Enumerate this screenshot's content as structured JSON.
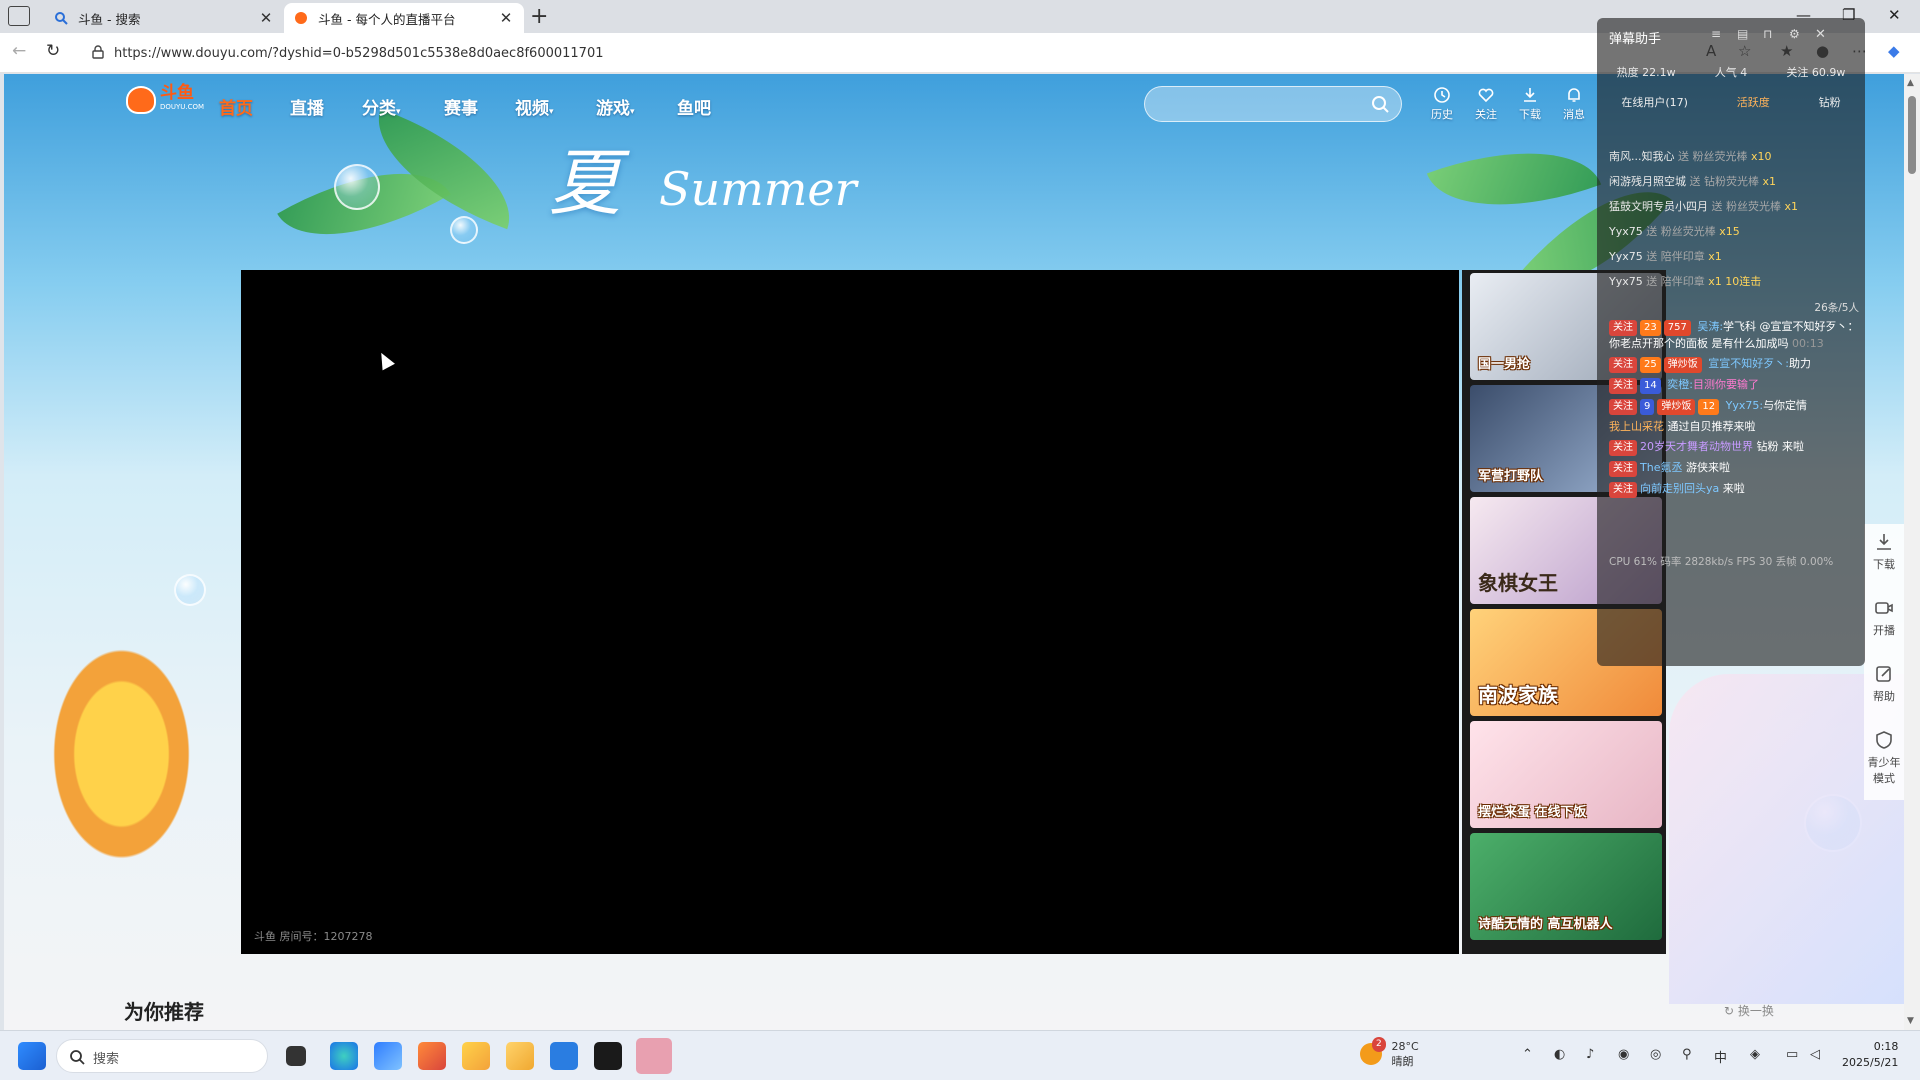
{
  "browser": {
    "tabs": [
      {
        "title": "斗鱼 - 搜索",
        "active": false
      },
      {
        "title": "斗鱼 - 每个人的直播平台",
        "active": true
      }
    ],
    "url": "https://www.douyu.com/?dyshid=0-b5298d501c5538e8d0aec8f600011701"
  },
  "site": {
    "logo_text": "斗鱼",
    "logo_sub": "DOUYU.COM",
    "nav": [
      "首页",
      "直播",
      "分类",
      "赛事",
      "视频",
      "游戏",
      "鱼吧"
    ],
    "tools": [
      "历史",
      "关注",
      "下载",
      "消息"
    ],
    "room_label": "斗鱼 房间号：1207278",
    "recommend_title": "为你推荐",
    "refresh_label": "换一换",
    "thumbs": [
      {
        "caption": "国一男抢"
      },
      {
        "caption": "军营打野队"
      },
      {
        "caption": "象棋女王"
      },
      {
        "caption": "南波家族"
      },
      {
        "caption": "摆烂来蛋 在线下饭"
      },
      {
        "caption": "诗酷无情的 高互机器人"
      }
    ],
    "side_menu": [
      "下载",
      "开播",
      "帮助",
      "青少年模式"
    ]
  },
  "danmu": {
    "title": "弹幕助手",
    "stats": [
      "热度 22.1w",
      "人气 4",
      "关注 60.9w"
    ],
    "tabs": [
      "在线用户(17)",
      "活跃度",
      "钻粉"
    ],
    "gifts": [
      {
        "user": "南风...知我心",
        "action": "送 粉丝荧光棒",
        "count": "x10"
      },
      {
        "user": "闲游残月照空城",
        "action": "送 钻粉荧光棒",
        "count": "x1"
      },
      {
        "user": "猛鼓文明专员小四月",
        "action": "送 粉丝荧光棒",
        "count": "x1"
      },
      {
        "user": "Yyx75",
        "action": "送 粉丝荧光棒",
        "count": "x15"
      },
      {
        "user": "Yyx75",
        "action": "送 陪伴印章",
        "count": "x1"
      },
      {
        "user": "Yyx75",
        "action": "送 陪伴印章",
        "count": "x1 10连击"
      }
    ],
    "online_count": "26条/5人",
    "chats": [
      {
        "badges": [
          "关注",
          "23",
          "757"
        ],
        "user": "吴涛:",
        "text": "学飞科 @宣宣不知好歹丶：你老点开那个的面板 是有什么加成吗",
        "time": "00:13"
      },
      {
        "badges": [
          "关注",
          "25",
          "弹炒饭"
        ],
        "user": "宣宣不知好歹丶:",
        "text": "助力",
        "time": ""
      },
      {
        "badges": [
          "关注",
          "14"
        ],
        "user": "奕橙:",
        "text": "目测你要输了",
        "time": ""
      },
      {
        "badges": [
          "关注",
          "9",
          "弹炒饭",
          "12"
        ],
        "user": "Yyx75:",
        "text": "与你定情",
        "time": ""
      }
    ],
    "enters": [
      {
        "user": "我上山采花",
        "text": "通过自贝推荐来啦"
      },
      {
        "user": "20岁天才舞者动物世界",
        "text": "钻粉 来啦"
      },
      {
        "user": "The氪丞",
        "text": "游侠来啦"
      },
      {
        "user": "向前走别回头ya",
        "text": "来啦"
      }
    ],
    "perf": "CPU 61% 码率 2828kb/s FPS 30 丢帧 0.00%"
  },
  "taskbar": {
    "search_label": "搜索",
    "weather_temp": "28°C",
    "weather_desc": "晴朗",
    "weather_badge": "2",
    "time": "0:18",
    "date": "2025/5/21"
  }
}
